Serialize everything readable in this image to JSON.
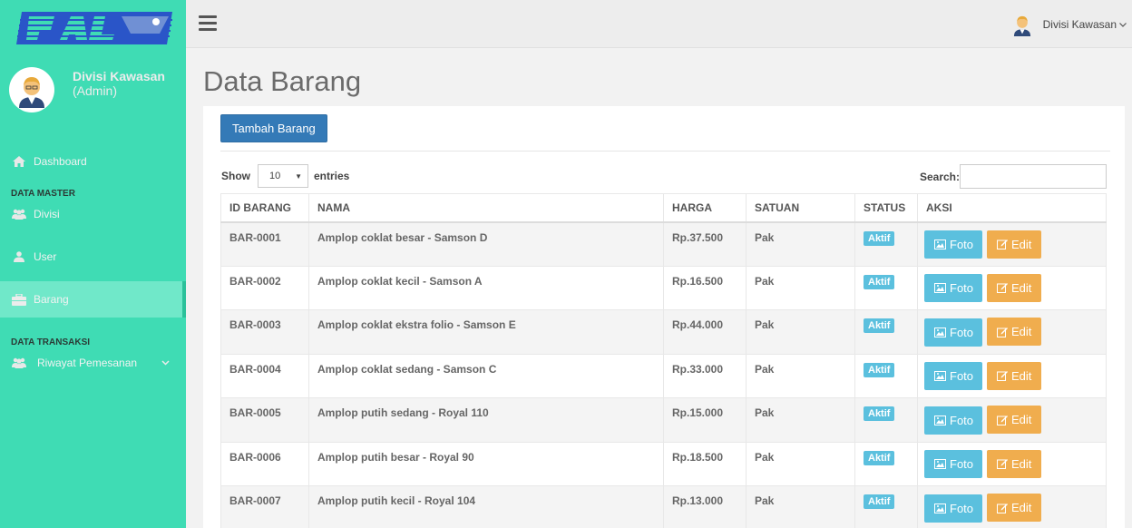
{
  "sidebar": {
    "profile": {
      "name": "Divisi Kawasan",
      "role": "(Admin)"
    },
    "dashboard": "Dashboard",
    "header_master": "DATA MASTER",
    "master_items": [
      {
        "label": "Divisi",
        "icon": "users-icon"
      },
      {
        "label": "User",
        "icon": "user-icon"
      },
      {
        "label": "Barang",
        "icon": "briefcase-icon",
        "active": true
      }
    ],
    "header_transaksi": "DATA TRANSAKSI",
    "transaksi_items": [
      {
        "label": "Riwayat Pemesanan",
        "icon": "users-icon"
      }
    ]
  },
  "topbar": {
    "user_name": "Divisi Kawasan"
  },
  "page": {
    "title": "Data Barang",
    "add_button": "Tambah Barang",
    "show_label": "Show",
    "page_length": "10",
    "entries_label": "entries",
    "search_label": "Search:",
    "search_value": ""
  },
  "table": {
    "columns": [
      "ID BARANG",
      "NAMA",
      "HARGA",
      "SATUAN",
      "STATUS",
      "AKSI"
    ],
    "foto_label": "Foto",
    "edit_label": "Edit",
    "rows": [
      {
        "id": "BAR-0001",
        "nama": "Amplop coklat besar - Samson D",
        "harga": "Rp.37.500",
        "satuan": "Pak",
        "status": "Aktif"
      },
      {
        "id": "BAR-0002",
        "nama": "Amplop coklat kecil - Samson A",
        "harga": "Rp.16.500",
        "satuan": "Pak",
        "status": "Aktif"
      },
      {
        "id": "BAR-0003",
        "nama": "Amplop coklat ekstra folio - Samson E",
        "harga": "Rp.44.000",
        "satuan": "Pak",
        "status": "Aktif"
      },
      {
        "id": "BAR-0004",
        "nama": "Amplop coklat sedang - Samson C",
        "harga": "Rp.33.000",
        "satuan": "Pak",
        "status": "Aktif"
      },
      {
        "id": "BAR-0005",
        "nama": "Amplop putih sedang - Royal 110",
        "harga": "Rp.15.000",
        "satuan": "Pak",
        "status": "Aktif"
      },
      {
        "id": "BAR-0006",
        "nama": "Amplop putih besar - Royal 90",
        "harga": "Rp.18.500",
        "satuan": "Pak",
        "status": "Aktif"
      },
      {
        "id": "BAR-0007",
        "nama": "Amplop putih kecil - Royal 104",
        "harga": "Rp.13.000",
        "satuan": "Pak",
        "status": "Aktif"
      }
    ]
  },
  "colors": {
    "sidebar_bg": "#3fdcb4",
    "primary": "#347ab7",
    "info": "#5bc0de",
    "warning": "#f0ad4e"
  }
}
